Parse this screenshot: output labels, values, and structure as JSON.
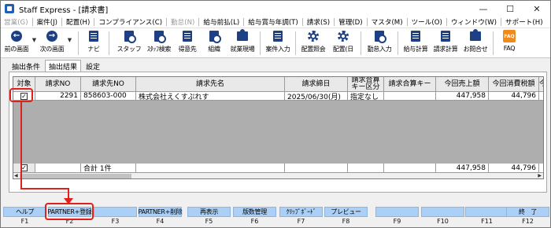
{
  "window": {
    "title": "Staff Express - [請求書]"
  },
  "menu": [
    "営業(G)",
    "案件(J)",
    "配置(H)",
    "コンプライアンス(C)",
    "勤怠(N)",
    "給与前払(L)",
    "給与賞与年調(T)",
    "請求(S)",
    "管理(D)",
    "マスタ(M)",
    "ツール(O)",
    "ウィンドウ(W)",
    "サポート(H)"
  ],
  "toolbar": {
    "back": "前の画面",
    "next": "次の画面",
    "navi": "ナビ",
    "staff": "スタッフ",
    "staff_search": "ｽﾀｯﾌ検索",
    "client": "得意先",
    "org": "組織",
    "site": "就業現場",
    "case_input": "案件入力",
    "haichi_shokai": "配置照会",
    "haichi_day": "配置(日",
    "kintai_input": "勤怠入力",
    "kyuyo_calc": "給与計算",
    "seikyu_calc": "請求計算",
    "contact": "お問合せ",
    "faq": "FAQ",
    "faq_logo": "FAQ"
  },
  "tabs": [
    "抽出条件",
    "抽出結果",
    "設定"
  ],
  "grid": {
    "headers": [
      "対象",
      "請求NO",
      "請求先NO",
      "請求先名",
      "請求締日",
      "請求合算キー区分",
      "請求合算キー",
      "今回売上額",
      "今回消費税額",
      "今"
    ],
    "rows": [
      {
        "checked": "✓",
        "no": "2291",
        "client_no": "858603-000",
        "name": "株式会社えくすぷれす",
        "close_date": "2025/06/30(月)",
        "sum_key_kubun": "指定なし",
        "sum_key": "",
        "sales": "447,958",
        "tax": "44,796"
      }
    ],
    "total": {
      "checked": "✓",
      "label": "合計 1件",
      "sales": "447,958",
      "tax": "44,796"
    }
  },
  "fkeys": [
    {
      "label": "ヘルプ",
      "key": "F1"
    },
    {
      "label": "PARTNER+登録",
      "key": "F2"
    },
    {
      "label": "",
      "key": "F3"
    },
    {
      "label": "PARTNER+削除",
      "key": "F4"
    },
    {
      "label": "再表示",
      "key": "F5"
    },
    {
      "label": "版数管理",
      "key": "F6"
    },
    {
      "label": "ｸﾘｯﾌﾟﾎﾞｰﾄﾞ",
      "key": "F7"
    },
    {
      "label": "プレビュー",
      "key": "F8"
    },
    {
      "label": "",
      "key": "F9"
    },
    {
      "label": "",
      "key": "F10"
    },
    {
      "label": "",
      "key": "F11"
    },
    {
      "label": "終　了",
      "key": "F12"
    }
  ],
  "annotation_color": "#e0201b"
}
